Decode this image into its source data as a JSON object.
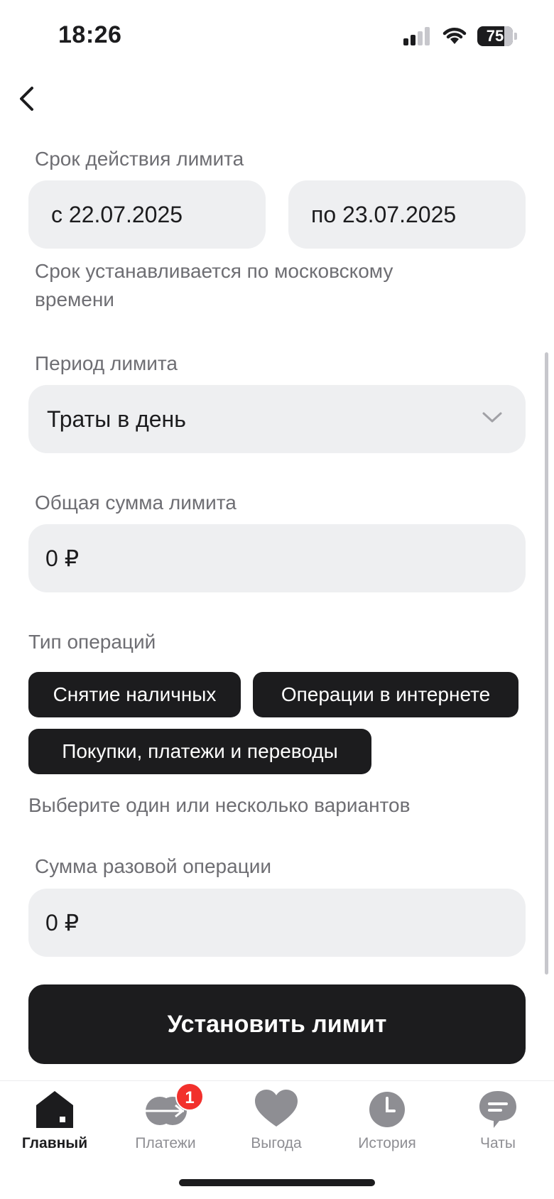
{
  "status_bar": {
    "time": "18:26",
    "battery": "75"
  },
  "validity": {
    "label": "Срок действия лимита",
    "from": "с 22.07.2025",
    "to": "по 23.07.2025",
    "hint_line1": "Срок устанавливается по московскому",
    "hint_line2": "времени"
  },
  "period": {
    "label": "Период лимита",
    "value": "Траты в день"
  },
  "total": {
    "label": "Общая сумма лимита",
    "value": "0 ₽"
  },
  "operations": {
    "label": "Тип операций",
    "chips": [
      "Снятие наличных",
      "Операции в интернете",
      "Покупки, платежи и переводы"
    ],
    "hint": "Выберите один или несколько вариантов"
  },
  "single": {
    "label": "Сумма разовой операции",
    "value": "0 ₽"
  },
  "submit_label": "Установить лимит",
  "tabs": [
    {
      "label": "Главный",
      "icon": "home-icon",
      "active": true
    },
    {
      "label": "Платежи",
      "icon": "payments-icon",
      "badge": "1"
    },
    {
      "label": "Выгода",
      "icon": "heart-icon"
    },
    {
      "label": "История",
      "icon": "clock-icon"
    },
    {
      "label": "Чаты",
      "icon": "chat-icon"
    }
  ],
  "colors": {
    "dark": "#1c1c1e",
    "field_bg": "#eeeff1",
    "muted": "#6e6e73",
    "badge": "#f2302c",
    "tab_icon": "#8e8e93"
  }
}
